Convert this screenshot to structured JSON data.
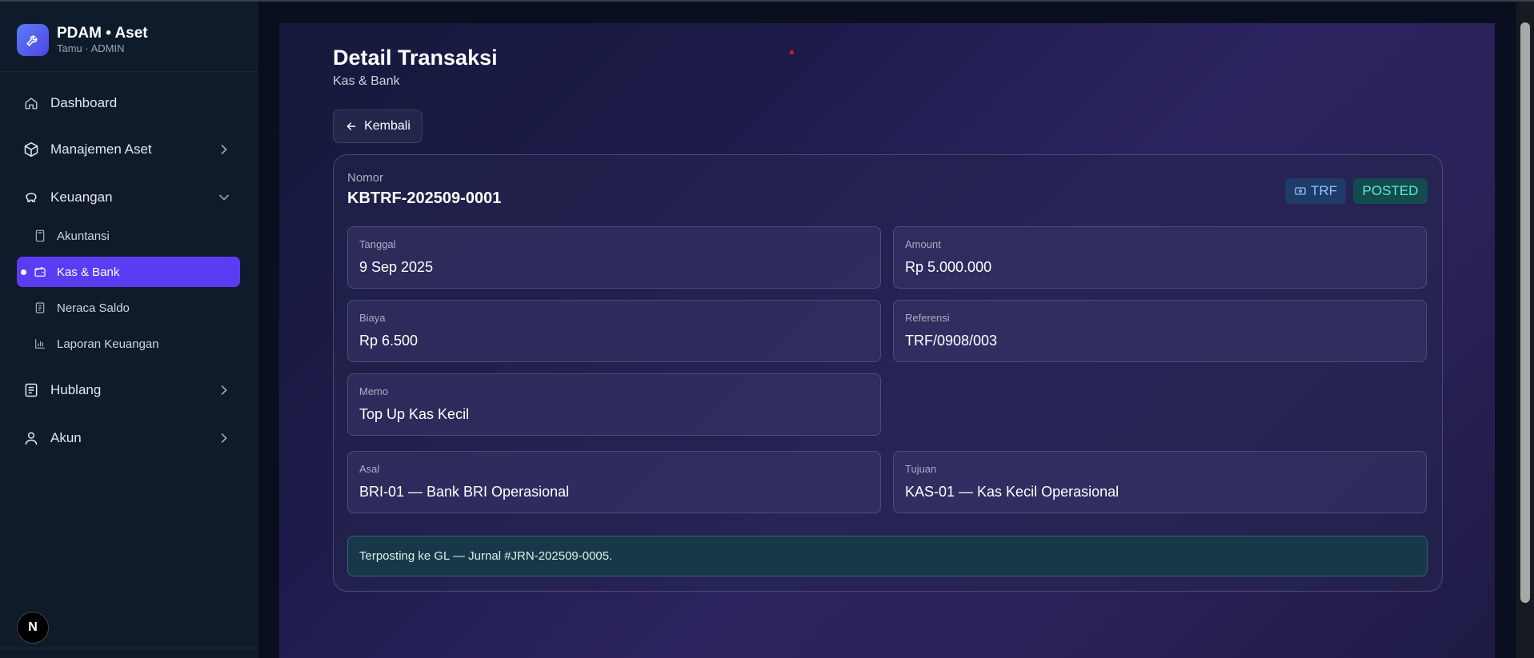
{
  "brand": {
    "title": "PDAM • Aset",
    "subtitle": "Tamu · ADMIN"
  },
  "sidebar": {
    "dashboard": "Dashboard",
    "manajemen_aset": "Manajemen Aset",
    "keuangan": "Keuangan",
    "keuangan_items": [
      "Akuntansi",
      "Kas & Bank",
      "Neraca Saldo",
      "Laporan Keuangan"
    ],
    "hublang": "Hublang",
    "akun": "Akun",
    "active_item": "Kas & Bank"
  },
  "page": {
    "title": "Detail Transaksi",
    "subtitle": "Kas & Bank",
    "back_label": "Kembali"
  },
  "detail": {
    "nomor_label": "Nomor",
    "nomor": "KBTRF-202509-0001",
    "type_badge": "TRF",
    "status_badge": "POSTED",
    "tanggal_label": "Tanggal",
    "tanggal": "9 Sep 2025",
    "amount_label": "Amount",
    "amount": "Rp 5.000.000",
    "biaya_label": "Biaya",
    "biaya": "Rp 6.500",
    "referensi_label": "Referensi",
    "referensi": "TRF/0908/003",
    "memo_label": "Memo",
    "memo": "Top Up Kas Kecil",
    "asal_label": "Asal",
    "asal": "BRI-01 — Bank BRI Operasional",
    "tujuan_label": "Tujuan",
    "tujuan": "KAS-01 — Kas Kecil Operasional",
    "notice": "Terposting ke GL — Jurnal #JRN-202509-0005."
  },
  "dev_badge": "N",
  "colors": {
    "active_nav": "#5b3cf2",
    "badge_trf_bg": "#1f3b68",
    "badge_posted_bg": "#134c4f",
    "notice_bg": "#18384a"
  }
}
